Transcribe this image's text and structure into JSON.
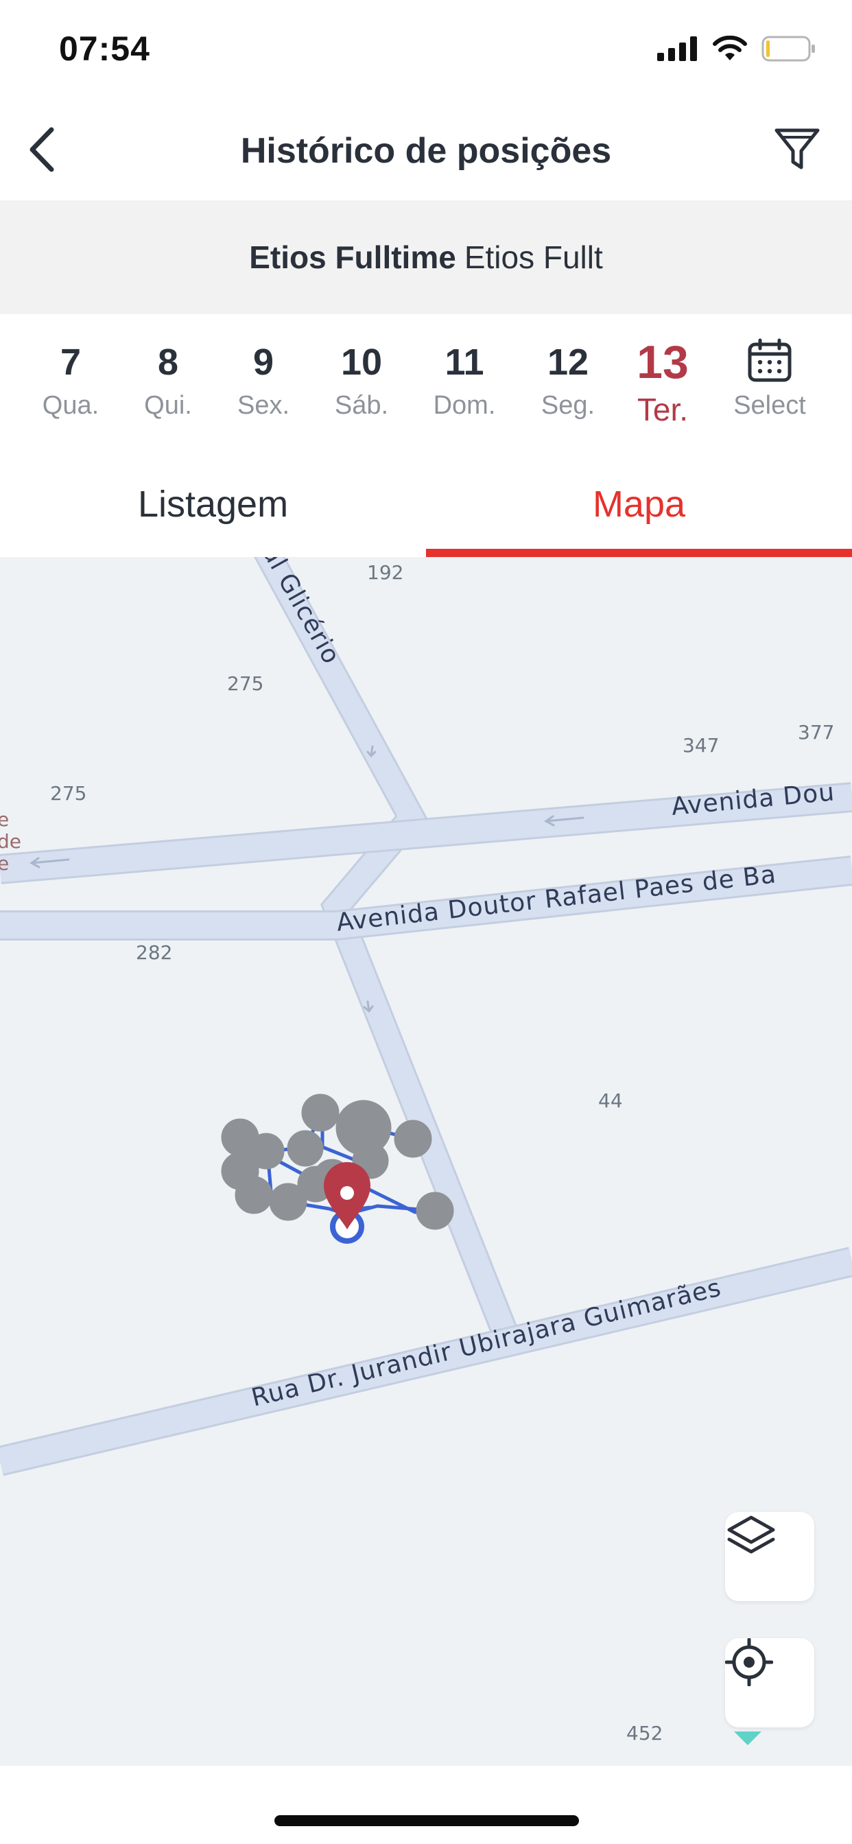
{
  "status_bar": {
    "time": "07:54",
    "icons": [
      "cellular-signal-icon",
      "wifi-icon",
      "battery-icon"
    ]
  },
  "header": {
    "title": "Histórico de posições",
    "back_icon": "chevron-left-icon",
    "filter_icon": "filter-icon"
  },
  "vehicle": {
    "name": "Etios Fulltime",
    "subtitle": "Etios Fullt"
  },
  "dates": [
    {
      "num": "7",
      "day": "Qua.",
      "active": false
    },
    {
      "num": "8",
      "day": "Qui.",
      "active": false
    },
    {
      "num": "9",
      "day": "Sex.",
      "active": false
    },
    {
      "num": "10",
      "day": "Sáb.",
      "active": false
    },
    {
      "num": "11",
      "day": "Dom.",
      "active": false
    },
    {
      "num": "12",
      "day": "Seg.",
      "active": false
    },
    {
      "num": "13",
      "day": "Ter.",
      "active": true
    }
  ],
  "date_select": {
    "label": "Select",
    "icon": "calendar-icon"
  },
  "tabs": {
    "list": "Listagem",
    "map": "Mapa",
    "active": "map"
  },
  "map": {
    "streets": {
      "street_glicerio": "al Glicério",
      "avenue_top": "Avenida Dou",
      "avenue_main": "Avenida Doutor Rafael Paes de Ba",
      "street_jurandir": "Rua Dr. Jurandir Ubirajara Guimarães"
    },
    "house_numbers": [
      "192",
      "275",
      "347",
      "377",
      "275",
      "282",
      "44",
      "452"
    ],
    "edge_text": [
      "e",
      "de",
      "e"
    ],
    "marker_icon": "map-pin-icon",
    "controls": {
      "layers_icon": "layers-icon",
      "locate_icon": "crosshair-icon"
    }
  },
  "colors": {
    "accent": "#e5322d",
    "active_date": "#b23a48",
    "route": "#3b63d4",
    "cluster": "#8e9196",
    "road": "#d5dff0",
    "map_bg": "#eef2f5"
  }
}
